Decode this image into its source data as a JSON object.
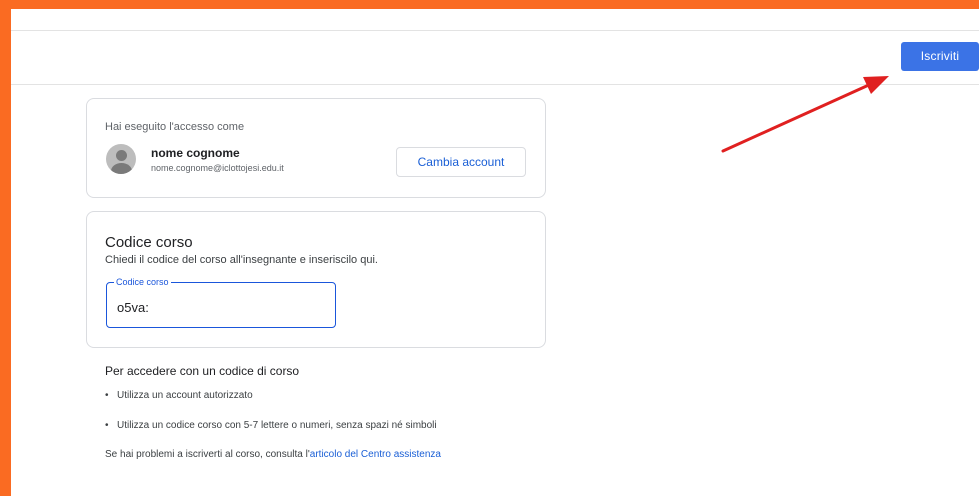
{
  "header": {
    "join_label": "Iscriviti"
  },
  "account": {
    "signed_in_label": "Hai eseguito l'accesso come",
    "name": "nome cognome",
    "email": "nome.cognome@iclottojesi.edu.it",
    "switch_label": "Cambia account"
  },
  "course_code": {
    "title": "Codice corso",
    "subtitle": "Chiedi il codice del corso all'insegnante e inseriscilo qui.",
    "field_label": "Codice corso",
    "value": "o5va:"
  },
  "help": {
    "title": "Per accedere con un codice di corso",
    "bullet": "•",
    "items": [
      "Utilizza un account autorizzato",
      "Utilizza un codice corso con 5-7 lettere o numeri, senza spazi né simboli"
    ],
    "footer_prefix": "Se hai problemi a iscriverti al corso, consulta l'",
    "footer_link": "articolo del Centro assistenza"
  },
  "colors": {
    "frame": "#fa6b22",
    "primary": "#3b73e6",
    "link": "#1a5fd6",
    "arrow": "#e02020"
  }
}
